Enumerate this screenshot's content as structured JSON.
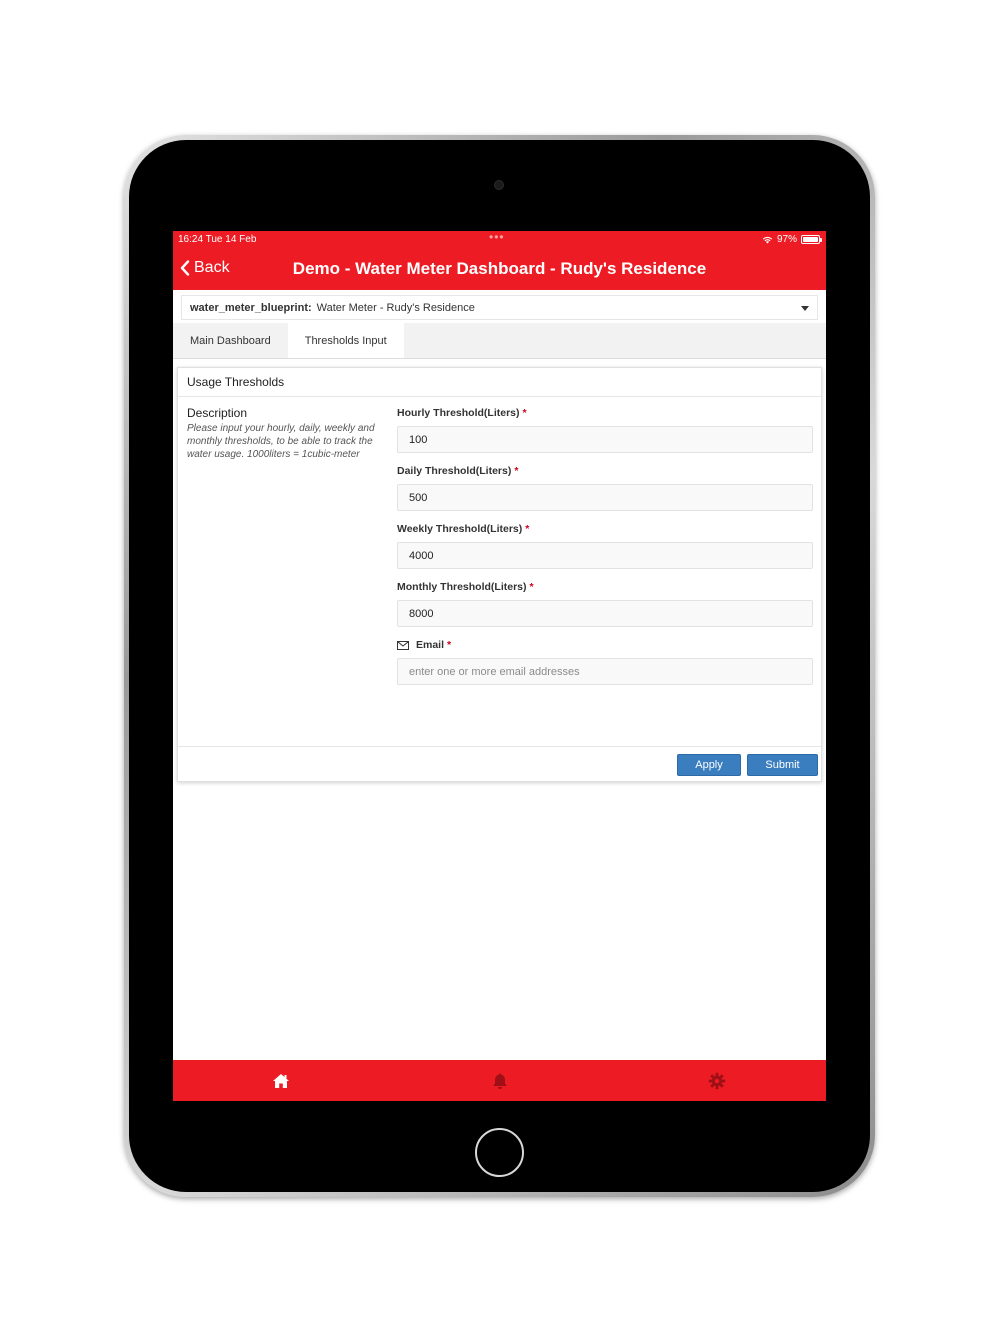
{
  "status_bar": {
    "time": "16:24  Tue 14 Feb",
    "dots": "•••",
    "battery": "97%"
  },
  "nav": {
    "back_label": "Back",
    "title": "Demo - Water Meter Dashboard - Rudy's Residence"
  },
  "selector": {
    "key": "water_meter_blueprint:",
    "value": "Water Meter - Rudy's Residence"
  },
  "tabs": [
    {
      "label": "Main Dashboard",
      "active": false
    },
    {
      "label": "Thresholds Input",
      "active": true
    }
  ],
  "panel": {
    "title": "Usage Thresholds",
    "description": {
      "title": "Description",
      "text": "Please input your hourly, daily, weekly and monthly thresholds, to be able to track the water usage. 1000liters = 1cubic-meter"
    },
    "fields": [
      {
        "label": "Hourly Threshold(Liters)",
        "required": "*",
        "value": "100"
      },
      {
        "label": "Daily Threshold(Liters)",
        "required": "*",
        "value": "500"
      },
      {
        "label": "Weekly Threshold(Liters)",
        "required": "*",
        "value": "4000"
      },
      {
        "label": "Monthly Threshold(Liters)",
        "required": "*",
        "value": "8000"
      }
    ],
    "email": {
      "label": "Email",
      "required": "*",
      "value": "",
      "placeholder": "enter one or more email addresses",
      "icon": "envelope-icon"
    },
    "apply_label": "Apply",
    "submit_label": "Submit"
  },
  "bottom_tabs": [
    {
      "name": "home",
      "icon": "home-icon",
      "color": "#ffffff"
    },
    {
      "name": "alerts",
      "icon": "bell-icon",
      "color": "#9e1016"
    },
    {
      "name": "settings",
      "icon": "gear-icon",
      "color": "#9e1016"
    }
  ],
  "colors": {
    "brand_red": "#ed1c24",
    "button_blue": "#3a7ebf",
    "required_red": "#d0021b"
  }
}
